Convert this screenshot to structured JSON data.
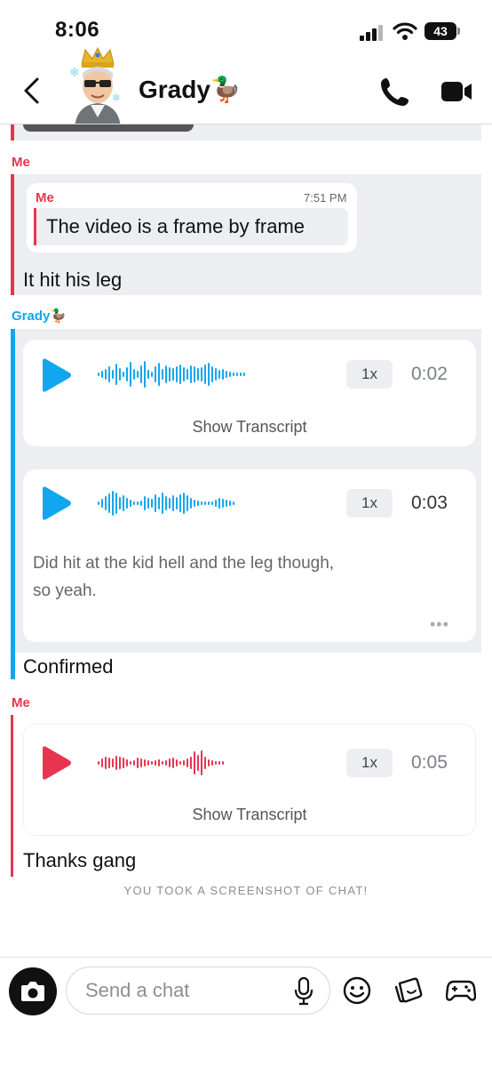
{
  "status": {
    "time": "8:06",
    "battery": "43"
  },
  "header": {
    "contact_name": "Grady🦆"
  },
  "messages": {
    "group1_sender": "Me",
    "quote_sender": "Me",
    "quote_time": "7:51 PM",
    "quote_text": "The video is a frame by frame",
    "reply_text": "It hit his leg",
    "group2_sender": "Grady🦆",
    "voice1": {
      "speed": "1x",
      "duration": "0:02",
      "show_transcript": "Show Transcript"
    },
    "voice2": {
      "speed": "1x",
      "duration": "0:03",
      "transcript_line1": "Did hit at the kid hell and the leg though,",
      "transcript_line2": "so yeah."
    },
    "confirmed_text": "Confirmed",
    "group3_sender": "Me",
    "voice3": {
      "speed": "1x",
      "duration": "0:05",
      "show_transcript": "Show Transcript"
    },
    "thanks_text": "Thanks gang",
    "screenshot_notice": "YOU TOOK A SCREENSHOT OF CHAT!"
  },
  "composer": {
    "placeholder": "Send a chat"
  },
  "colors": {
    "me": "#e8354f",
    "friend": "#12a6f0",
    "bubble_bg": "#eceef1"
  },
  "icons": [
    "back-chevron-icon",
    "phone-icon",
    "video-call-icon",
    "play-icon",
    "camera-icon",
    "microphone-icon",
    "smiley-icon",
    "sticker-icon",
    "game-controller-icon"
  ]
}
